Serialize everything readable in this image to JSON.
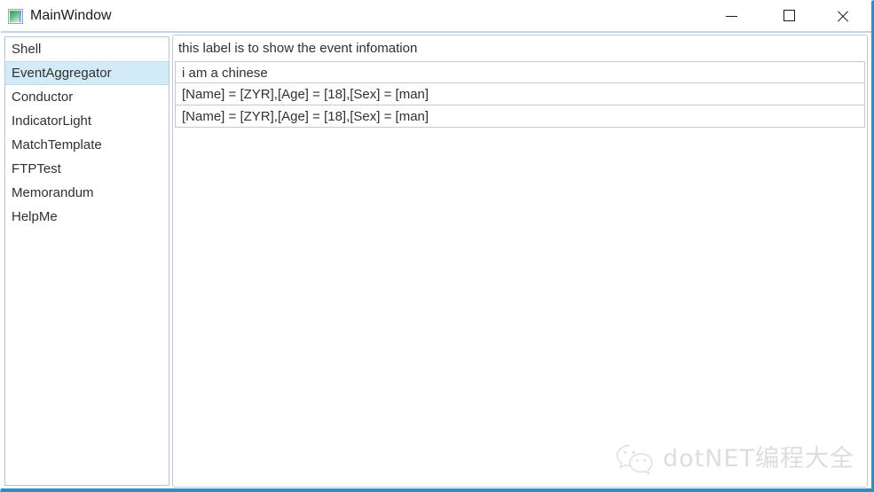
{
  "window": {
    "title": "MainWindow",
    "icon": "app-icon",
    "controls": {
      "minimize": "minimize-icon",
      "maximize": "maximize-icon",
      "close": "close-icon"
    }
  },
  "sidebar": {
    "items": [
      {
        "label": "Shell",
        "selected": false
      },
      {
        "label": "EventAggregator",
        "selected": true
      },
      {
        "label": "Conductor",
        "selected": false
      },
      {
        "label": "IndicatorLight",
        "selected": false
      },
      {
        "label": "MatchTemplate",
        "selected": false
      },
      {
        "label": "FTPTest",
        "selected": false
      },
      {
        "label": "Memorandum",
        "selected": false
      },
      {
        "label": "HelpMe",
        "selected": false
      }
    ]
  },
  "main": {
    "info_label": "this label is to show the event infomation",
    "events": [
      "i am a chinese",
      "[Name] = [ZYR],[Age] = [18],[Sex] = [man]",
      "[Name] = [ZYR],[Age] = [18],[Sex] = [man]"
    ]
  },
  "watermark": {
    "icon": "wechat-icon",
    "text": "dotNET编程大全"
  },
  "colors": {
    "accent_border": "#2f8fc4",
    "selection": "#d3eaf7",
    "panel_border": "#b9c9dd",
    "text": "#303030"
  }
}
